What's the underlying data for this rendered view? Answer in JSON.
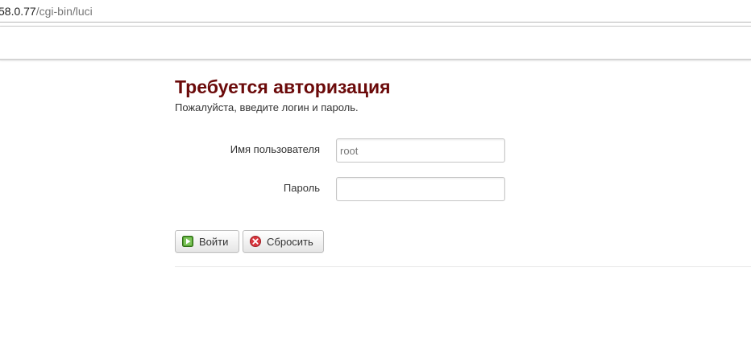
{
  "browser": {
    "url_host": "58.0.77",
    "url_path": "/cgi-bin/luci"
  },
  "login": {
    "title": "Требуется авторизация",
    "subtitle": "Пожалуйста, введите логин и пароль.",
    "username_label": "Имя пользователя",
    "username_value": "root",
    "password_label": "Пароль",
    "password_value": "",
    "login_button": "Войти",
    "reset_button": "Сбросить"
  },
  "colors": {
    "title": "#6b0a0a",
    "login_icon": "#4c9a2a",
    "reset_icon": "#d9363e"
  },
  "icons": {
    "login": "play-icon",
    "reset": "cancel-icon"
  }
}
